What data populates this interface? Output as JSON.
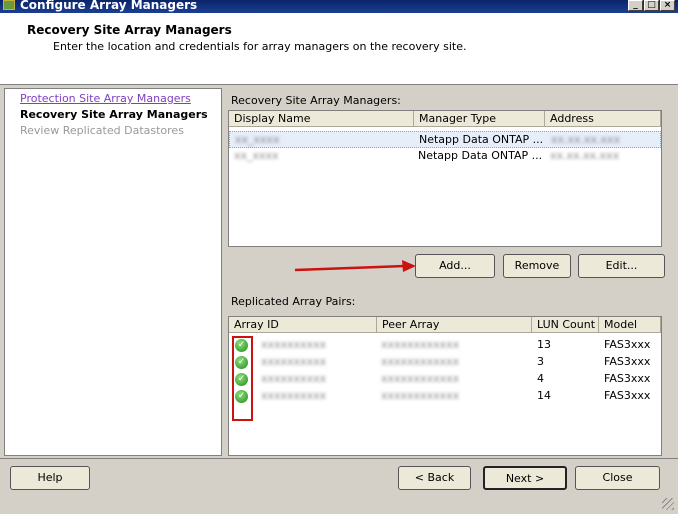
{
  "window": {
    "title": "Configure Array Managers"
  },
  "header": {
    "title": "Recovery Site Array Managers",
    "subtitle": "Enter the location and credentials for array managers on the recovery site."
  },
  "nav": [
    {
      "label": "Protection Site Array Managers",
      "state": "visited"
    },
    {
      "label": "Recovery Site Array Managers",
      "state": "current"
    },
    {
      "label": "Review Replicated Datastores",
      "state": "disabled"
    }
  ],
  "managers": {
    "label": "Recovery Site Array Managers:",
    "columns": [
      "Display Name",
      "Manager Type",
      "Address"
    ],
    "rows": [
      {
        "name": "xx_xxxx",
        "type": "Netapp Data ONTAP ...",
        "address": "xx.xx.xx.xxx"
      },
      {
        "name": "xx_xxxx",
        "type": "Netapp Data ONTAP ...",
        "address": "xx.xx.xx.xxx"
      }
    ]
  },
  "buttons": {
    "add": "Add...",
    "remove": "Remove",
    "edit": "Edit...",
    "help": "Help",
    "back": "< Back",
    "next": "Next >",
    "close": "Close"
  },
  "pairs": {
    "label": "Replicated Array Pairs:",
    "columns": [
      "Array ID",
      "Peer Array",
      "LUN Count",
      "Model"
    ],
    "rows": [
      {
        "array_id": "xxxxxxxxxx",
        "peer": "xxxxxxxxxxxx",
        "lun": "13",
        "model": "FAS3xxx"
      },
      {
        "array_id": "xxxxxxxxxx",
        "peer": "xxxxxxxxxxxx",
        "lun": "3",
        "model": "FAS3xxx"
      },
      {
        "array_id": "xxxxxxxxxx",
        "peer": "xxxxxxxxxxxx",
        "lun": "4",
        "model": "FAS3xxx"
      },
      {
        "array_id": "xxxxxxxxxx",
        "peer": "xxxxxxxxxxxx",
        "lun": "14",
        "model": "FAS3xxx"
      }
    ]
  },
  "colors": {
    "titlebar": "#0a246a",
    "annotation": "#cc1111",
    "check": "#2a9a2a"
  }
}
